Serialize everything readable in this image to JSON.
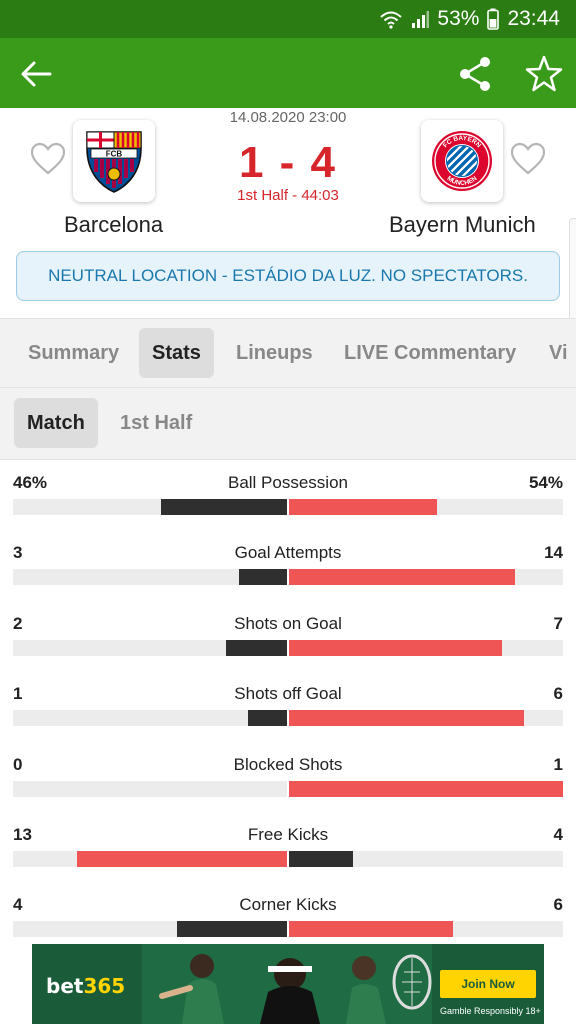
{
  "status_bar": {
    "battery": "53%",
    "time": "23:44",
    "icons": [
      "wifi-icon",
      "signal-icon",
      "battery-icon"
    ]
  },
  "app_bar": {
    "icons": [
      "back-arrow-icon",
      "share-icon",
      "star-icon"
    ]
  },
  "match": {
    "datetime": "14.08.2020 23:00",
    "score": "1 - 4",
    "period": "1st Half - 44:03",
    "home": {
      "name": "Barcelona",
      "crest_text": "FCB",
      "colors": [
        "#a50044",
        "#004d98",
        "#edbb00"
      ]
    },
    "away": {
      "name": "Bayern Munich",
      "crest_text": "FC BAYERN MÜNCHEN",
      "colors": [
        "#dc052d",
        "#0066b2"
      ]
    },
    "notice": "NEUTRAL LOCATION - ESTÁDIO DA LUZ. NO SPECTATORS."
  },
  "tabs": [
    {
      "label": "Summary",
      "active": false
    },
    {
      "label": "Stats",
      "active": true
    },
    {
      "label": "Lineups",
      "active": false
    },
    {
      "label": "LIVE Commentary",
      "active": false
    },
    {
      "label": "Vi",
      "active": false
    }
  ],
  "subtabs": [
    {
      "label": "Match",
      "active": true
    },
    {
      "label": "1st Half",
      "active": false
    }
  ],
  "colors": {
    "dark_bar": "#2f2f2f",
    "red_bar": "#f05555",
    "score_red": "#d7262b",
    "header_green": "#3a9a1a"
  },
  "stats": [
    {
      "name": "Ball Possession",
      "home": "46%",
      "away": "54%",
      "home_value": 46,
      "away_value": 54
    },
    {
      "name": "Goal Attempts",
      "home": "3",
      "away": "14",
      "home_value": 3,
      "away_value": 14
    },
    {
      "name": "Shots on Goal",
      "home": "2",
      "away": "7",
      "home_value": 2,
      "away_value": 7
    },
    {
      "name": "Shots off Goal",
      "home": "1",
      "away": "6",
      "home_value": 1,
      "away_value": 6
    },
    {
      "name": "Blocked Shots",
      "home": "0",
      "away": "1",
      "home_value": 0,
      "away_value": 1
    },
    {
      "name": "Free Kicks",
      "home": "13",
      "away": "4",
      "home_value": 13,
      "away_value": 4
    },
    {
      "name": "Corner Kicks",
      "home": "4",
      "away": "6",
      "home_value": 4,
      "away_value": 6
    }
  ],
  "ad": {
    "brand_main": "bet",
    "brand_accent": "365",
    "cta": "Join Now",
    "small_print": "Gamble Responsibly 18+"
  }
}
